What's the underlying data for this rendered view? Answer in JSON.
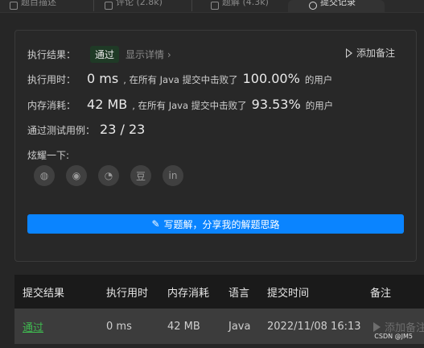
{
  "tabs": [
    {
      "label": "题目描述",
      "active": false
    },
    {
      "label": "评论 (2.8k)",
      "active": false
    },
    {
      "label": "题解 (4.3k)",
      "active": false
    },
    {
      "label": "提交记录",
      "active": true
    }
  ],
  "result": {
    "label": "执行结果：",
    "status": "通过",
    "details_link": "显示详情 ›",
    "add_note": "添加备注"
  },
  "runtime": {
    "label": "执行用时：",
    "value": "0 ms",
    "mid_text": ", 在所有 Java 提交中击败了",
    "percent": "100.00%",
    "suffix": "的用户"
  },
  "memory": {
    "label": "内存消耗：",
    "value": "42 MB",
    "mid_text": ", 在所有 Java 提交中击败了",
    "percent": "93.53%",
    "suffix": "的用户"
  },
  "testcases": {
    "label": "通过测试用例：",
    "value": "23 / 23"
  },
  "share": {
    "label": "炫耀一下:",
    "icons": [
      "wechat-icon",
      "weibo-icon",
      "qq-icon",
      "douban-icon",
      "linkedin-icon"
    ],
    "icon_glyphs": [
      "◍",
      "◉",
      "◔",
      "豆",
      "in"
    ]
  },
  "write_solution_button": "写题解，分享我的解题思路",
  "table": {
    "headers": [
      "提交结果",
      "执行用时",
      "内存消耗",
      "语言",
      "提交时间",
      "备注"
    ],
    "rows": [
      {
        "status": "通过",
        "runtime": "0 ms",
        "memory": "42 MB",
        "language": "Java",
        "time": "2022/11/08 16:13",
        "note": "添加备注"
      }
    ]
  },
  "watermark": "CSDN @JM5",
  "colors": {
    "accent": "#0a84ff",
    "pass": "#3fb950"
  }
}
